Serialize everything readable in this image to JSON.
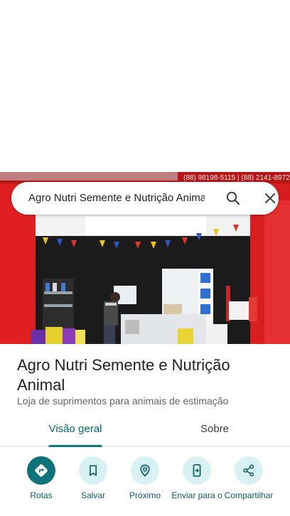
{
  "search": {
    "query": "Agro Nutri Semente e Nutrição Animal"
  },
  "photo": {
    "phone_text": "(88) 98198-5115 | (88) 2141-8972"
  },
  "place": {
    "name": "Agro Nutri Semente e Nutrição Animal",
    "category": "Loja de suprimentos para animais de estimação"
  },
  "tabs": [
    {
      "label": "Visão geral",
      "active": true
    },
    {
      "label": "Sobre",
      "active": false
    }
  ],
  "actions": [
    {
      "label": "Rotas",
      "icon": "directions-icon"
    },
    {
      "label": "Salvar",
      "icon": "bookmark-icon"
    },
    {
      "label": "Próximo",
      "icon": "nearby-icon"
    },
    {
      "label": "Enviar para o",
      "icon": "send-to-phone-icon"
    },
    {
      "label": "Compartilhar",
      "icon": "share-icon"
    }
  ],
  "colors": {
    "accent": "#0d7379",
    "accent_light": "#d8f1f3",
    "storefront_red": "#d81f1f"
  }
}
